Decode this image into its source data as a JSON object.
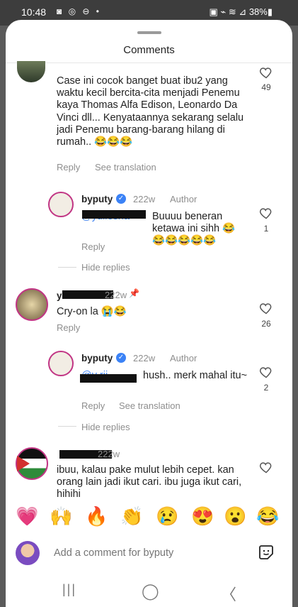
{
  "status_bar": {
    "time": "10:48",
    "left_icons": "◙ ◎ ⊖ •",
    "right_text": "▣ ⌁ ≋ ⊿ 38%▮"
  },
  "sheet": {
    "title": "Comments"
  },
  "comments": [
    {
      "text": "Case ini cocok banget buat ibu2 yang waktu kecil bercita-cita menjadi Penemu kaya Thomas Alfa Edison, Leonardo Da Vinci dll... Kenyataannya sekarang selalu jadi Penemu barang-barang hilang di rumah.. 😂😂😂",
      "likes": "49",
      "reply": "Reply",
      "translate": "See translation"
    },
    {
      "author": "byputy",
      "time": "222w",
      "author_tag": "Author",
      "mention": "@yuliesha",
      "text": "Buuuu beneran ketawa ini sihh 😂😂😂😂😂😂",
      "likes": "1",
      "reply": "Reply",
      "hide": "Hide replies"
    },
    {
      "author": "y        tt",
      "time": "222w",
      "text": "Cry-on la 😭😂",
      "likes": "26",
      "reply": "Reply"
    },
    {
      "author": "byputy",
      "time": "222w",
      "author_tag": "Author",
      "mention": "@y         rii",
      "text": "hush.. merk mahal itu~",
      "likes": "2",
      "reply": "Reply",
      "translate": "See translation",
      "hide": "Hide replies"
    },
    {
      "author": "        ",
      "time": "222w",
      "text": "ibuu, kalau pake mulut lebih cepet. kan orang lain jadi ikut cari. ibu juga ikut cari, hihihi"
    }
  ],
  "emoji_bar": [
    "💗",
    "🙌",
    "🔥",
    "👏",
    "😢",
    "😍",
    "😮",
    "😂"
  ],
  "composer": {
    "placeholder": "Add a comment for byputy"
  },
  "nav": {
    "recents": "|||",
    "home": "◯",
    "back": "〈"
  },
  "colors": {
    "accent_blue": "#3b82f6",
    "ring": "#c13584",
    "muted": "#8e8e8e"
  }
}
